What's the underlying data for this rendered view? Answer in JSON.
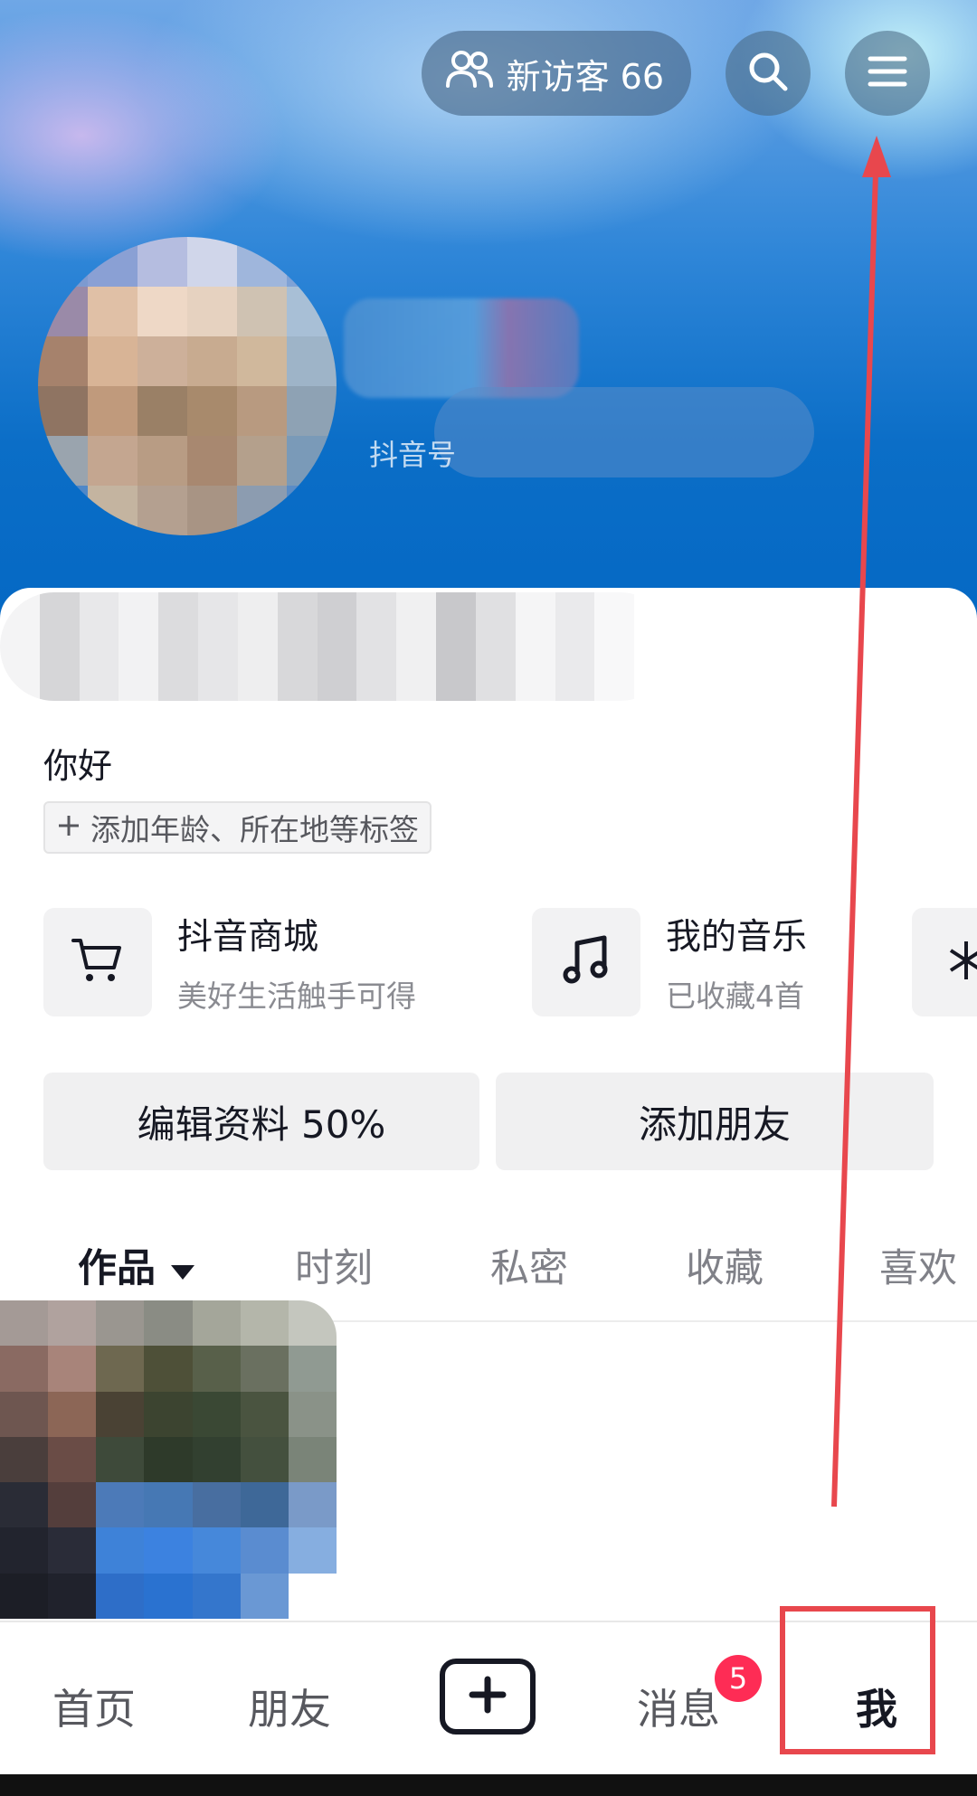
{
  "header": {
    "visitors_label": "新访客 66",
    "id_prefix": "抖音号"
  },
  "profile": {
    "bio": "你好",
    "add_tags": "添加年龄、所在地等标签"
  },
  "shortcuts": [
    {
      "title": "抖音商城",
      "subtitle": "美好生活触手可得",
      "icon": "cart-icon"
    },
    {
      "title": "我的音乐",
      "subtitle": "已收藏4首",
      "icon": "music-note-icon"
    }
  ],
  "actions": {
    "edit_profile": "编辑资料 50%",
    "add_friends": "添加朋友"
  },
  "tabs": [
    {
      "label": "作品",
      "active": true
    },
    {
      "label": "时刻"
    },
    {
      "label": "私密"
    },
    {
      "label": "收藏"
    },
    {
      "label": "喜欢"
    }
  ],
  "bottom_nav": {
    "home": "首页",
    "friends": "朋友",
    "create": "+",
    "messages": "消息",
    "messages_badge": "5",
    "me": "我"
  },
  "colors": {
    "accent_red": "#fe2c55",
    "annotation_red": "#e8474d",
    "banner_blue": "#0b6ec7"
  }
}
